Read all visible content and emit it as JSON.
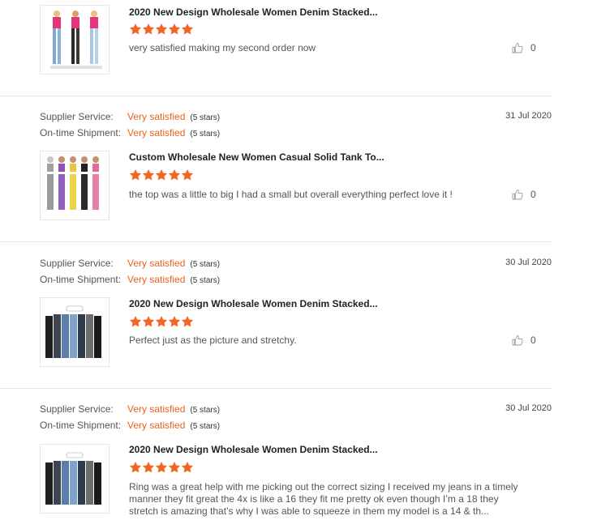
{
  "meta_labels": {
    "supplier": "Supplier Service:",
    "shipment": "On-time Shipment:"
  },
  "reviews": [
    {
      "title": "2020 New Design Wholesale Women Denim Stacked...",
      "text": "very satisfied making my second order now",
      "helpful_count": "0",
      "rating": 5
    },
    {
      "supplier_value": "Very satisfied",
      "supplier_stars": "(5 stars)",
      "shipment_value": "Very satisfied",
      "shipment_stars": "(5 stars)",
      "date": "31 Jul 2020",
      "title": "Custom Wholesale New Women Casual Solid Tank To...",
      "text": "the top was a little to big I had a small but overall everything perfect love it !",
      "helpful_count": "0",
      "rating": 5
    },
    {
      "supplier_value": "Very satisfied",
      "supplier_stars": "(5 stars)",
      "shipment_value": "Very satisfied",
      "shipment_stars": "(5 stars)",
      "date": "30 Jul 2020",
      "title": "2020 New Design Wholesale Women Denim Stacked...",
      "text": "Perfect just as the picture and stretchy.",
      "helpful_count": "0",
      "rating": 5
    },
    {
      "supplier_value": "Very satisfied",
      "supplier_stars": "(5 stars)",
      "shipment_value": "Very satisfied",
      "shipment_stars": "(5 stars)",
      "date": "30 Jul 2020",
      "title": "2020 New Design Wholesale Women Denim Stacked...",
      "text": "Ring was a great help with me picking out the correct sizing I received my jeans in a timely manner they fit great the 4x is like a 16 they fit me pretty ok even though I’m a 18 they stretch is amazing that’s why I was able to squeeze in them my model is a 14 & th...",
      "rating": 5
    }
  ],
  "colors": {
    "accent": "#e8631a",
    "star": "#f26522",
    "divider": "#e5e5e5"
  },
  "icons": {
    "star": "star-icon",
    "helpful": "thumbs-up-icon"
  }
}
